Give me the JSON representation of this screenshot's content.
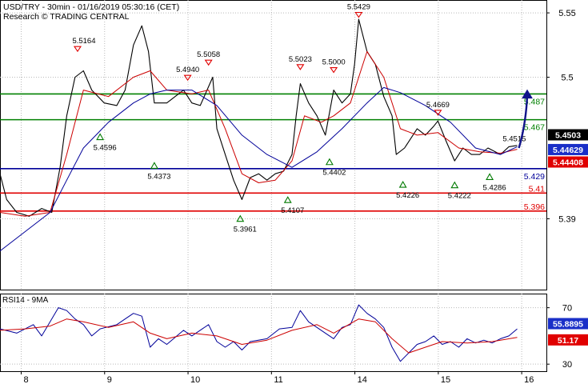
{
  "header": {
    "line1": "USD/TRY - 30min - 01/16/2019 05:30:16 (CET)",
    "line2": "Research © TRADING CENTRAL"
  },
  "chart_data": [
    {
      "type": "line",
      "name": "price",
      "y_axis_ticks": [
        5.55,
        5.5,
        5.39
      ],
      "ylim": [
        5.335,
        5.56
      ],
      "x_day_labels": [
        {
          "label": "8",
          "t": 0.35
        },
        {
          "label": "9",
          "t": 1.35
        },
        {
          "label": "10",
          "t": 2.35
        },
        {
          "label": "11",
          "t": 3.35
        },
        {
          "label": "14",
          "t": 4.35
        },
        {
          "label": "15",
          "t": 5.35
        },
        {
          "label": "16",
          "t": 6.35
        }
      ],
      "xlim": [
        0,
        6.55
      ],
      "series": [
        {
          "color": "#000000",
          "points": [
            [
              0.0,
              5.425
            ],
            [
              0.08,
              5.405
            ],
            [
              0.2,
              5.395
            ],
            [
              0.35,
              5.392
            ],
            [
              0.5,
              5.398
            ],
            [
              0.62,
              5.395
            ],
            [
              0.72,
              5.43
            ],
            [
              0.8,
              5.47
            ],
            [
              0.9,
              5.5
            ],
            [
              1.0,
              5.505
            ],
            [
              1.1,
              5.49
            ],
            [
              1.25,
              5.48
            ],
            [
              1.4,
              5.478
            ],
            [
              1.5,
              5.49
            ],
            [
              1.6,
              5.525
            ],
            [
              1.7,
              5.54
            ],
            [
              1.78,
              5.52
            ],
            [
              1.85,
              5.48
            ],
            [
              2.0,
              5.48
            ],
            [
              2.2,
              5.49
            ],
            [
              2.3,
              5.48
            ],
            [
              2.4,
              5.478
            ],
            [
              2.55,
              5.5
            ],
            [
              2.6,
              5.46
            ],
            [
              2.7,
              5.44
            ],
            [
              2.8,
              5.42
            ],
            [
              2.9,
              5.405
            ],
            [
              3.0,
              5.422
            ],
            [
              3.1,
              5.425
            ],
            [
              3.2,
              5.42
            ],
            [
              3.3,
              5.425
            ],
            [
              3.4,
              5.427
            ],
            [
              3.5,
              5.44
            ],
            [
              3.55,
              5.47
            ],
            [
              3.6,
              5.495
            ],
            [
              3.7,
              5.48
            ],
            [
              3.8,
              5.47
            ],
            [
              3.9,
              5.455
            ],
            [
              4.0,
              5.49
            ],
            [
              4.1,
              5.48
            ],
            [
              4.2,
              5.487
            ],
            [
              4.25,
              5.51
            ],
            [
              4.3,
              5.545
            ],
            [
              4.4,
              5.52
            ],
            [
              4.5,
              5.51
            ],
            [
              4.6,
              5.485
            ],
            [
              4.7,
              5.47
            ],
            [
              4.75,
              5.44
            ],
            [
              4.85,
              5.445
            ],
            [
              5.0,
              5.46
            ],
            [
              5.1,
              5.455
            ],
            [
              5.2,
              5.462
            ],
            [
              5.25,
              5.466
            ],
            [
              5.35,
              5.45
            ],
            [
              5.45,
              5.435
            ],
            [
              5.55,
              5.445
            ],
            [
              5.65,
              5.44
            ],
            [
              5.75,
              5.44
            ],
            [
              5.85,
              5.445
            ],
            [
              6.0,
              5.44
            ],
            [
              6.1,
              5.446
            ],
            [
              6.2,
              5.447
            ]
          ]
        },
        {
          "color": "#cc0000",
          "points": [
            [
              0.0,
              5.395
            ],
            [
              0.3,
              5.392
            ],
            [
              0.6,
              5.395
            ],
            [
              0.8,
              5.44
            ],
            [
              1.0,
              5.49
            ],
            [
              1.3,
              5.485
            ],
            [
              1.6,
              5.5
            ],
            [
              1.8,
              5.505
            ],
            [
              2.0,
              5.49
            ],
            [
              2.3,
              5.487
            ],
            [
              2.5,
              5.49
            ],
            [
              2.7,
              5.46
            ],
            [
              2.9,
              5.425
            ],
            [
              3.1,
              5.418
            ],
            [
              3.3,
              5.42
            ],
            [
              3.5,
              5.435
            ],
            [
              3.65,
              5.47
            ],
            [
              3.85,
              5.465
            ],
            [
              4.0,
              5.47
            ],
            [
              4.2,
              5.48
            ],
            [
              4.4,
              5.52
            ],
            [
              4.6,
              5.5
            ],
            [
              4.8,
              5.46
            ],
            [
              5.0,
              5.455
            ],
            [
              5.25,
              5.457
            ],
            [
              5.5,
              5.445
            ],
            [
              5.75,
              5.442
            ],
            [
              6.0,
              5.441
            ],
            [
              6.2,
              5.444
            ]
          ]
        },
        {
          "color": "#000099",
          "points": [
            [
              0.0,
              5.365
            ],
            [
              0.3,
              5.38
            ],
            [
              0.6,
              5.395
            ],
            [
              0.8,
              5.42
            ],
            [
              1.0,
              5.445
            ],
            [
              1.3,
              5.465
            ],
            [
              1.6,
              5.48
            ],
            [
              1.8,
              5.487
            ],
            [
              2.0,
              5.49
            ],
            [
              2.3,
              5.49
            ],
            [
              2.6,
              5.478
            ],
            [
              2.9,
              5.455
            ],
            [
              3.2,
              5.44
            ],
            [
              3.5,
              5.43
            ],
            [
              3.8,
              5.442
            ],
            [
              4.1,
              5.46
            ],
            [
              4.4,
              5.48
            ],
            [
              4.6,
              5.492
            ],
            [
              4.8,
              5.488
            ],
            [
              5.1,
              5.478
            ],
            [
              5.4,
              5.465
            ],
            [
              5.7,
              5.445
            ],
            [
              6.0,
              5.44
            ],
            [
              6.2,
              5.446
            ]
          ]
        }
      ],
      "horizontal_levels": [
        {
          "value": 5.487,
          "label": "5.487",
          "color": "#008000"
        },
        {
          "value": 5.467,
          "label": "5.467",
          "color": "#008000"
        },
        {
          "value": 5.429,
          "label": "5.429",
          "color": "#000099"
        },
        {
          "value": 5.41,
          "label": "5.41",
          "color": "#e00000"
        },
        {
          "value": 5.396,
          "label": "5.396",
          "color": "#e00000"
        }
      ],
      "price_tags": [
        {
          "value": 5.4503,
          "label": "5.4503",
          "bg": "#000000",
          "fg": "#ffffff"
        },
        {
          "value": 5.44629,
          "label": "5.44629",
          "bg": "#1a2fc8",
          "fg": "#ffffff"
        },
        {
          "value": 5.44408,
          "label": "5.44408",
          "bg": "#e00000",
          "fg": "#ffffff"
        }
      ],
      "peak_annotations": [
        {
          "t": 0.93,
          "value": 5.5164,
          "label": "5.5164"
        },
        {
          "t": 2.25,
          "value": 5.494,
          "label": "5.4940"
        },
        {
          "t": 2.5,
          "value": 5.5058,
          "label": "5.5058"
        },
        {
          "t": 3.6,
          "value": 5.5023,
          "label": "5.5023"
        },
        {
          "t": 4.0,
          "value": 5.5,
          "label": "5.5000"
        },
        {
          "t": 4.3,
          "value": 5.5429,
          "label": "5.5429"
        },
        {
          "t": 5.25,
          "value": 5.4669,
          "label": "5.4669"
        }
      ],
      "trough_annotations": [
        {
          "t": 1.2,
          "value": 5.4596,
          "label": "5.4596"
        },
        {
          "t": 1.85,
          "value": 5.4373,
          "label": "5.4373"
        },
        {
          "t": 2.88,
          "value": 5.3961,
          "label": "5.3961"
        },
        {
          "t": 3.45,
          "value": 5.4107,
          "label": "5.4107"
        },
        {
          "t": 3.95,
          "value": 5.4402,
          "label": "5.4402"
        },
        {
          "t": 4.83,
          "value": 5.4226,
          "label": "5.4226"
        },
        {
          "t": 5.45,
          "value": 5.4222,
          "label": "5.4222"
        },
        {
          "t": 5.87,
          "value": 5.4286,
          "label": "5.4286"
        }
      ],
      "last_label": {
        "t": 6.05,
        "value": 5.4515,
        "label": "5.4515"
      },
      "forecast_arrow": {
        "from": [
          6.22,
          5.445
        ],
        "to": [
          6.32,
          5.49
        ]
      }
    },
    {
      "type": "line",
      "name": "rsi",
      "title": "RSI14 - 9MA",
      "y_axis_ticks": [
        70,
        30
      ],
      "ylim": [
        25,
        80
      ],
      "xlim": [
        0,
        6.55
      ],
      "series": [
        {
          "color": "#000099",
          "points": [
            [
              0.0,
              55
            ],
            [
              0.2,
              52
            ],
            [
              0.4,
              58
            ],
            [
              0.5,
              50
            ],
            [
              0.6,
              60
            ],
            [
              0.7,
              70
            ],
            [
              0.8,
              68
            ],
            [
              0.9,
              62
            ],
            [
              1.0,
              58
            ],
            [
              1.1,
              50
            ],
            [
              1.2,
              55
            ],
            [
              1.4,
              58
            ],
            [
              1.5,
              62
            ],
            [
              1.6,
              66
            ],
            [
              1.7,
              64
            ],
            [
              1.8,
              42
            ],
            [
              1.9,
              48
            ],
            [
              2.0,
              44
            ],
            [
              2.2,
              54
            ],
            [
              2.3,
              50
            ],
            [
              2.5,
              58
            ],
            [
              2.6,
              46
            ],
            [
              2.7,
              42
            ],
            [
              2.8,
              46
            ],
            [
              2.9,
              40
            ],
            [
              3.0,
              46
            ],
            [
              3.2,
              48
            ],
            [
              3.35,
              55
            ],
            [
              3.5,
              56
            ],
            [
              3.6,
              68
            ],
            [
              3.7,
              60
            ],
            [
              3.8,
              56
            ],
            [
              3.9,
              52
            ],
            [
              4.0,
              48
            ],
            [
              4.1,
              56
            ],
            [
              4.2,
              58
            ],
            [
              4.3,
              72
            ],
            [
              4.4,
              66
            ],
            [
              4.5,
              62
            ],
            [
              4.6,
              56
            ],
            [
              4.7,
              42
            ],
            [
              4.8,
              32
            ],
            [
              4.9,
              38
            ],
            [
              5.0,
              44
            ],
            [
              5.1,
              46
            ],
            [
              5.2,
              50
            ],
            [
              5.3,
              44
            ],
            [
              5.4,
              46
            ],
            [
              5.5,
              42
            ],
            [
              5.6,
              48
            ],
            [
              5.7,
              45
            ],
            [
              5.8,
              47
            ],
            [
              5.9,
              45
            ],
            [
              6.0,
              48
            ],
            [
              6.1,
              50
            ],
            [
              6.2,
              55
            ]
          ]
        },
        {
          "color": "#cc0000",
          "points": [
            [
              0.0,
              54
            ],
            [
              0.3,
              55
            ],
            [
              0.6,
              57
            ],
            [
              0.8,
              62
            ],
            [
              1.0,
              60
            ],
            [
              1.3,
              56
            ],
            [
              1.6,
              60
            ],
            [
              1.8,
              52
            ],
            [
              2.0,
              48
            ],
            [
              2.3,
              52
            ],
            [
              2.6,
              50
            ],
            [
              2.9,
              44
            ],
            [
              3.2,
              47
            ],
            [
              3.5,
              54
            ],
            [
              3.8,
              58
            ],
            [
              4.0,
              52
            ],
            [
              4.3,
              62
            ],
            [
              4.5,
              60
            ],
            [
              4.7,
              48
            ],
            [
              4.9,
              38
            ],
            [
              5.1,
              42
            ],
            [
              5.3,
              46
            ],
            [
              5.6,
              45
            ],
            [
              5.9,
              46
            ],
            [
              6.2,
              49
            ]
          ]
        }
      ],
      "value_tags": [
        {
          "value": 55.8895,
          "label": "55.8895",
          "bg": "#1a2fc8",
          "fg": "#ffffff"
        },
        {
          "value": 51.17,
          "label": "51.17",
          "bg": "#e00000",
          "fg": "#ffffff"
        }
      ]
    }
  ],
  "colors": {
    "grid": "#b9b9b9",
    "axis": "#000000"
  }
}
